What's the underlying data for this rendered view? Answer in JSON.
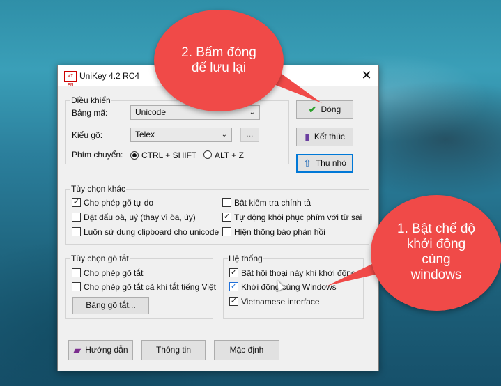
{
  "window": {
    "title": "UniKey 4.2 RC4",
    "icon_text": "VI EN"
  },
  "control": {
    "legend": "Điều khiển",
    "charset_label": "Bảng mã:",
    "charset_value": "Unicode",
    "method_label": "Kiểu gõ:",
    "method_value": "Telex",
    "dots_label": "...",
    "switch_label": "Phím chuyển:",
    "switch_options": [
      {
        "label": "CTRL + SHIFT",
        "selected": true
      },
      {
        "label": "ALT + Z",
        "selected": false
      }
    ]
  },
  "buttons": {
    "close": "Đóng",
    "exit": "Kết thúc",
    "minimize": "Thu nhỏ",
    "shortcut_table": "Bảng gõ tắt...",
    "help": "Hướng dẫn",
    "info": "Thông tin",
    "default": "Mặc định"
  },
  "other_options": {
    "legend": "Tùy chọn khác",
    "items": [
      {
        "label": "Cho phép gõ tự do",
        "checked": true
      },
      {
        "label": "Đặt dấu oà, uý (thay vì òa, úy)",
        "checked": false
      },
      {
        "label": "Luôn sử dụng clipboard cho unicode",
        "checked": false
      },
      {
        "label": "Bật kiểm tra chính tả",
        "checked": false
      },
      {
        "label": "Tự động khôi phục phím với từ sai",
        "checked": true
      },
      {
        "label": "Hiện thông báo phản hồi",
        "checked": false
      }
    ]
  },
  "shortcut_options": {
    "legend": "Tùy chọn gõ tắt",
    "items": [
      {
        "label": "Cho phép gõ tắt",
        "checked": false
      },
      {
        "label": "Cho phép gõ tắt cả khi tắt tiếng Việt",
        "checked": false
      }
    ]
  },
  "system": {
    "legend": "Hệ thống",
    "items": [
      {
        "label": "Bật hội thoại này khi khởi động",
        "checked": true
      },
      {
        "label": "Khởi động cùng Windows",
        "checked": true
      },
      {
        "label": "Vietnamese interface",
        "checked": true
      }
    ]
  },
  "callouts": {
    "top": [
      "2. Bấm đóng",
      "để lưu lại"
    ],
    "right": [
      "1. Bật chế độ",
      "khởi động",
      "cùng",
      "windows"
    ]
  },
  "colors": {
    "callout": "#f04a48",
    "focus": "#0078d7",
    "check_green": "#2aa02a"
  }
}
